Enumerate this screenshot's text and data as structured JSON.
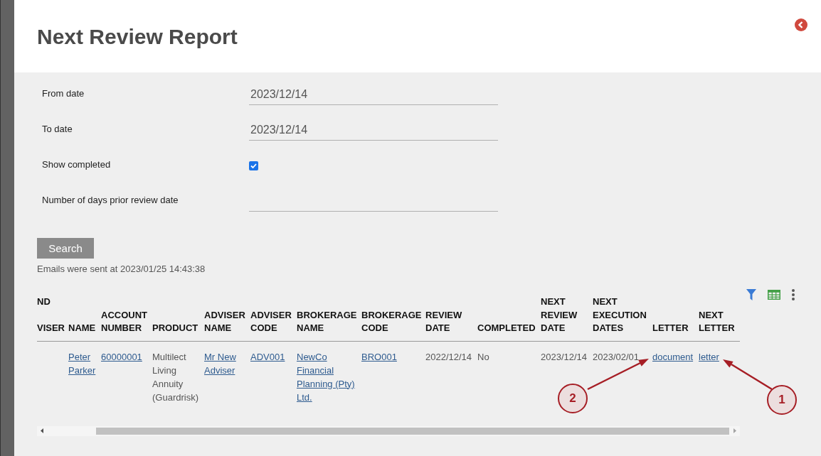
{
  "header": {
    "title": "Next Review Report"
  },
  "form": {
    "fields": [
      {
        "kind": "date",
        "label": "From date",
        "value": "2023/12/14"
      },
      {
        "kind": "date",
        "label": "To date",
        "value": "2023/12/14"
      },
      {
        "kind": "checkbox",
        "label": "Show completed",
        "checked": true
      },
      {
        "kind": "number",
        "label": "Number of days prior review date"
      }
    ]
  },
  "search_button": "Search",
  "status_message": "Emails were sent at 2023/01/25 14:43:38",
  "table": {
    "columns": [
      {
        "lines": [
          "ND",
          "VISER"
        ]
      },
      {
        "lines": [
          "NAME"
        ]
      },
      {
        "lines": [
          "ACCOUNT",
          "NUMBER"
        ]
      },
      {
        "lines": [
          "PRODUCT"
        ]
      },
      {
        "lines": [
          "ADVISER",
          "NAME"
        ]
      },
      {
        "lines": [
          "ADVISER",
          "CODE"
        ]
      },
      {
        "lines": [
          "BROKERAGE",
          "NAME"
        ]
      },
      {
        "lines": [
          "BROKERAGE",
          "CODE"
        ]
      },
      {
        "lines": [
          "REVIEW",
          "DATE"
        ]
      },
      {
        "lines": [
          "COMPLETED"
        ]
      },
      {
        "lines": [
          "NEXT",
          "REVIEW",
          "DATE"
        ]
      },
      {
        "lines": [
          "NEXT",
          "EXECUTION",
          "DATES"
        ]
      },
      {
        "lines": [
          "LETTER"
        ]
      },
      {
        "lines": [
          "NEXT",
          "LETTER"
        ]
      }
    ],
    "rows": [
      {
        "cells": [
          "",
          {
            "kind": "link",
            "text": "Peter Parker"
          },
          {
            "kind": "link",
            "text": "60000001"
          },
          {
            "kind": "text",
            "text": "Multilect Living Annuity (Guardrisk)"
          },
          {
            "kind": "link",
            "text": "Mr New Adviser"
          },
          {
            "kind": "link",
            "text": "ADV001"
          },
          {
            "kind": "link",
            "text": "NewCo Financial Planning (Pty) Ltd."
          },
          {
            "kind": "link",
            "text": "BRO001"
          },
          {
            "kind": "text",
            "text": "2022/12/14"
          },
          {
            "kind": "text",
            "text": "No"
          },
          {
            "kind": "text",
            "text": "2023/12/14"
          },
          {
            "kind": "text",
            "text": "2023/02/01"
          },
          {
            "kind": "link",
            "text": "document"
          },
          {
            "kind": "link",
            "text": "letter"
          }
        ]
      }
    ]
  },
  "annotations": [
    {
      "label": "2"
    },
    {
      "label": "1"
    }
  ]
}
